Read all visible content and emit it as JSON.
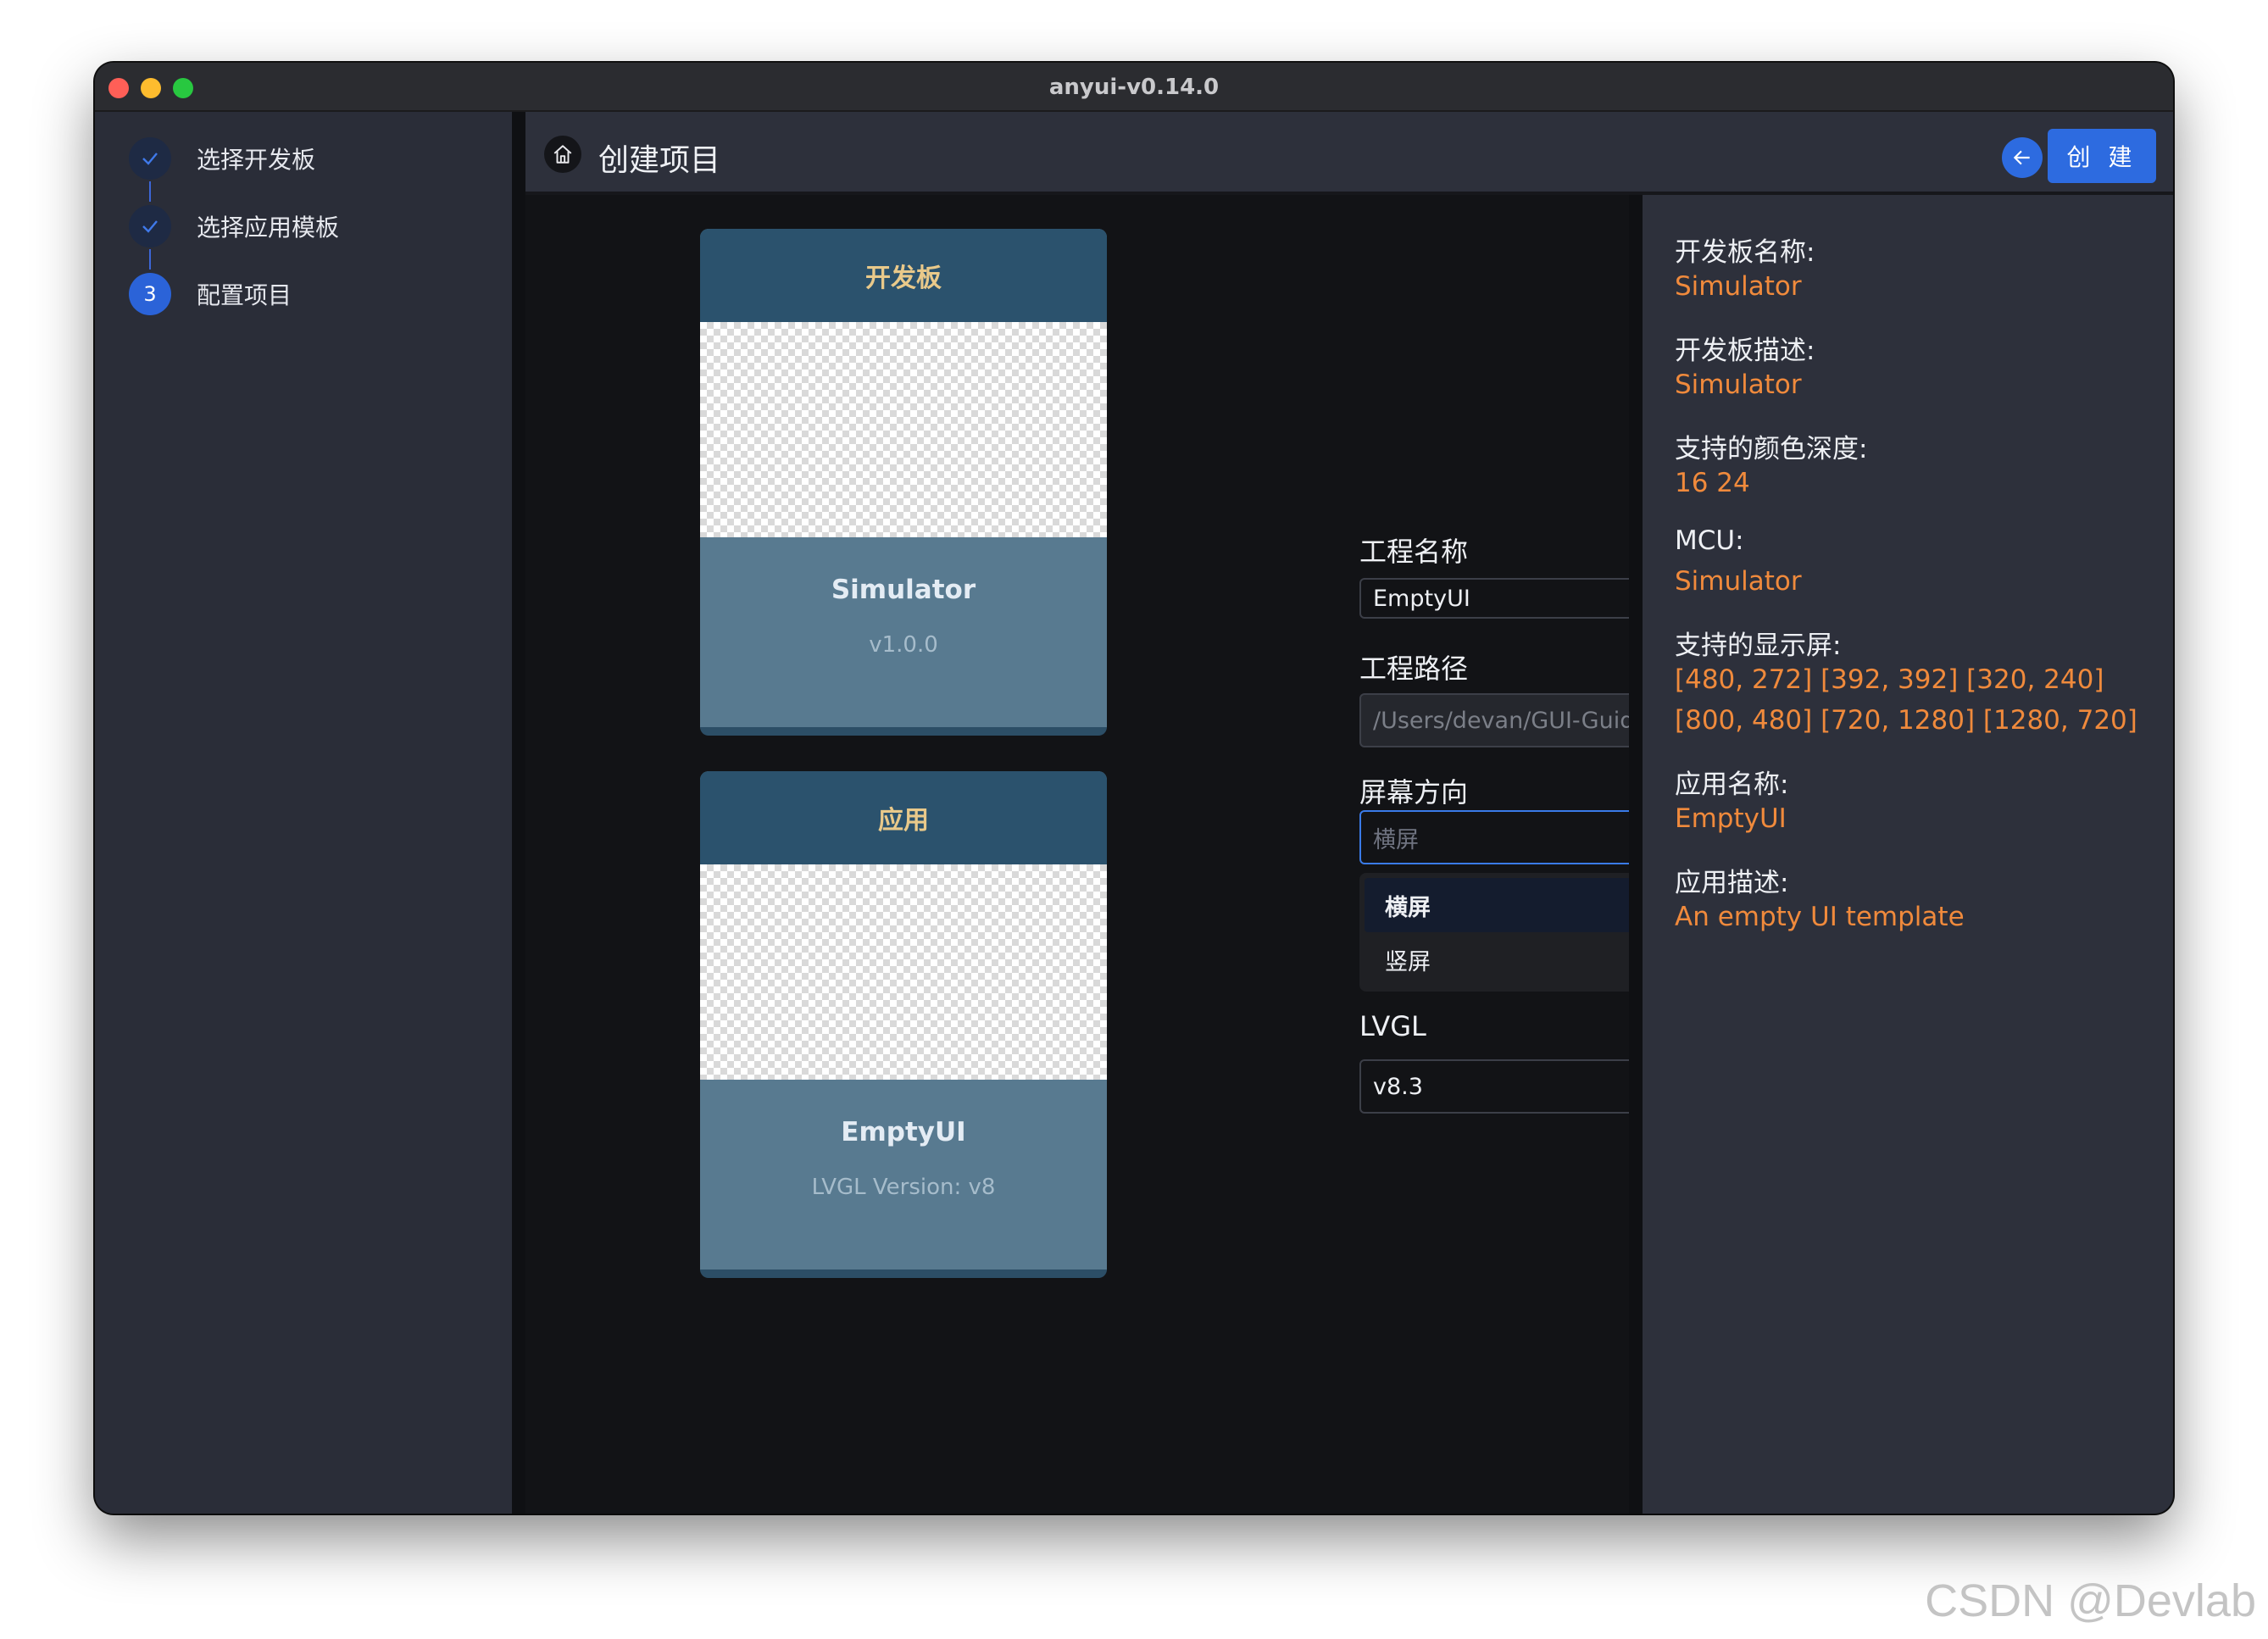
{
  "window": {
    "title": "anyui-v0.14.0"
  },
  "steps": [
    {
      "label": "选择开发板",
      "state": "done"
    },
    {
      "label": "选择应用模板",
      "state": "done"
    },
    {
      "label": "配置项目",
      "state": "active",
      "number": "3"
    }
  ],
  "header": {
    "title": "创建项目",
    "create_label": "创 建",
    "icons": [
      "home-icon",
      "arrow-left-icon"
    ]
  },
  "cards": {
    "board": {
      "title": "开发板",
      "name": "Simulator",
      "sub": "v1.0.0"
    },
    "app": {
      "title": "应用",
      "name": "EmptyUI",
      "sub": "LVGL Version: v8"
    }
  },
  "form": {
    "project_name_label": "工程名称",
    "project_name_value": "EmptyUI",
    "project_path_label": "工程路径",
    "project_path_value": "/Users/devan/GUI-Guider-Pr",
    "orientation_label": "屏幕方向",
    "orientation_value": "横屏",
    "orientation_options": [
      "横屏",
      "竖屏"
    ],
    "lvgl_label": "LVGL",
    "lvgl_value": "v8.3"
  },
  "info": {
    "board_name_label": "开发板名称:",
    "board_name": "Simulator",
    "board_desc_label": "开发板描述:",
    "board_desc": "Simulator",
    "color_depth_label": "支持的颜色深度:",
    "color_depth": "16 24",
    "mcu_label": "MCU:",
    "mcu": "Simulator",
    "displays_label": "支持的显示屏:",
    "displays_line1": "[480, 272] [392, 392] [320, 240]",
    "displays_line2": "[800, 480] [720, 1280] [1280, 720]",
    "app_name_label": "应用名称:",
    "app_name": "EmptyUI",
    "app_desc_label": "应用描述:",
    "app_desc": "An empty UI template"
  },
  "colors": {
    "accent": "#2d6be0",
    "value": "#f08a3c",
    "card_title": "#e9c98a"
  },
  "watermark": "CSDN @Devlab"
}
